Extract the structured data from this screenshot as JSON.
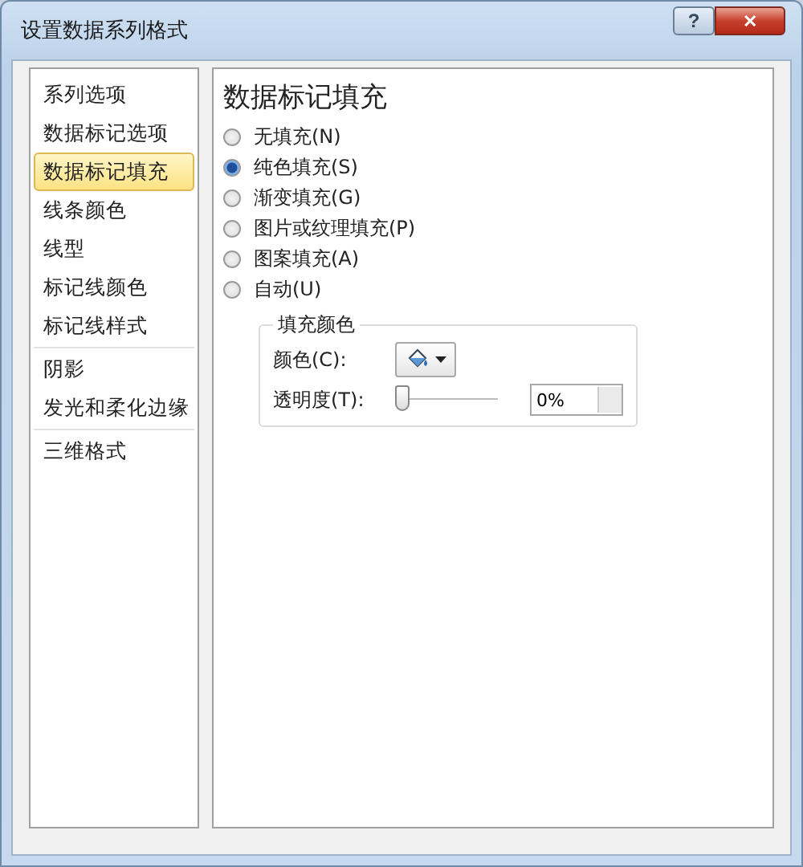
{
  "window": {
    "title": "设置数据系列格式",
    "help": "?",
    "close": "✕"
  },
  "sidebar": {
    "groups": [
      {
        "items": [
          {
            "label": "系列选项",
            "selected": false
          },
          {
            "label": "数据标记选项",
            "selected": false
          },
          {
            "label": "数据标记填充",
            "selected": true
          },
          {
            "label": "线条颜色",
            "selected": false
          },
          {
            "label": "线型",
            "selected": false
          },
          {
            "label": "标记线颜色",
            "selected": false
          },
          {
            "label": "标记线样式",
            "selected": false
          }
        ]
      },
      {
        "items": [
          {
            "label": "阴影",
            "selected": false
          },
          {
            "label": "发光和柔化边缘",
            "selected": false
          }
        ]
      },
      {
        "items": [
          {
            "label": "三维格式",
            "selected": false
          }
        ]
      }
    ]
  },
  "panel": {
    "heading": "数据标记填充",
    "options": [
      {
        "label": "无填充(N)",
        "selected": false
      },
      {
        "label": "纯色填充(S)",
        "selected": true
      },
      {
        "label": "渐变填充(G)",
        "selected": false
      },
      {
        "label": "图片或纹理填充(P)",
        "selected": false
      },
      {
        "label": "图案填充(A)",
        "selected": false
      },
      {
        "label": "自动(U)",
        "selected": false
      }
    ],
    "fill_color": {
      "legend": "填充颜色",
      "color_label": "颜色(C):",
      "transparency_label": "透明度(T):",
      "transparency": {
        "level": 0
      },
      "transparency_value": "0%"
    }
  }
}
